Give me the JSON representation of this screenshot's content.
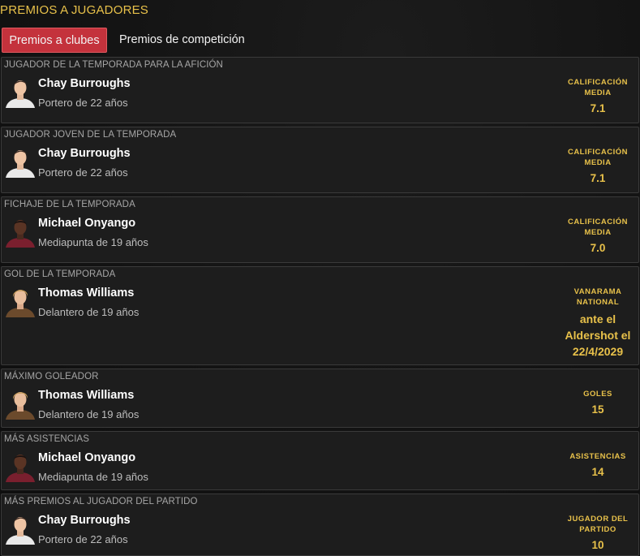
{
  "page": {
    "title": "PREMIOS A JUGADORES"
  },
  "tabs": [
    {
      "label": "Premios a clubes",
      "active": true
    },
    {
      "label": "Premios de competición",
      "active": false
    }
  ],
  "colors": {
    "accent_gold": "#e8c14a",
    "tab_active_bg": "#c4323c",
    "card_bg": "#1d1d1d",
    "card_border": "#3a3a3a"
  },
  "awards": [
    {
      "category": "JUGADOR DE LA TEMPORADA PARA LA AFICIÓN",
      "player": "Chay Burroughs",
      "description": "Portero de 22 años",
      "avatar_icon": "player-photo-light-hair",
      "stat_label": "CALIFICACIÓN MEDIA",
      "stat_value": "7.1"
    },
    {
      "category": "JUGADOR JOVEN DE LA TEMPORADA",
      "player": "Chay Burroughs",
      "description": "Portero de 22 años",
      "avatar_icon": "player-photo-light-hair",
      "stat_label": "CALIFICACIÓN MEDIA",
      "stat_value": "7.1"
    },
    {
      "category": "FICHAJE DE LA TEMPORADA",
      "player": "Michael Onyango",
      "description": "Mediapunta de 19 años",
      "avatar_icon": "player-photo-dark",
      "stat_label": "CALIFICACIÓN MEDIA",
      "stat_value": "7.0"
    },
    {
      "category": "GOL DE LA TEMPORADA",
      "player": "Thomas Williams",
      "description": "Delantero de 19 años",
      "avatar_icon": "player-photo-blond",
      "stat_label": "VANARAMA NATIONAL",
      "stat_value": "ante el Aldershot el 22/4/2029"
    },
    {
      "category": "MÁXIMO GOLEADOR",
      "player": "Thomas Williams",
      "description": "Delantero de 19 años",
      "avatar_icon": "player-photo-blond",
      "stat_label": "GOLES",
      "stat_value": "15"
    },
    {
      "category": "MÁS ASISTENCIAS",
      "player": "Michael Onyango",
      "description": "Mediapunta de 19 años",
      "avatar_icon": "player-photo-dark",
      "stat_label": "ASISTENCIAS",
      "stat_value": "14"
    },
    {
      "category": "MÁS PREMIOS AL JUGADOR DEL PARTIDO",
      "player": "Chay Burroughs",
      "description": "Portero de 22 años",
      "avatar_icon": "player-photo-light-hair",
      "stat_label": "JUGADOR DEL PARTIDO",
      "stat_value": "10"
    }
  ]
}
